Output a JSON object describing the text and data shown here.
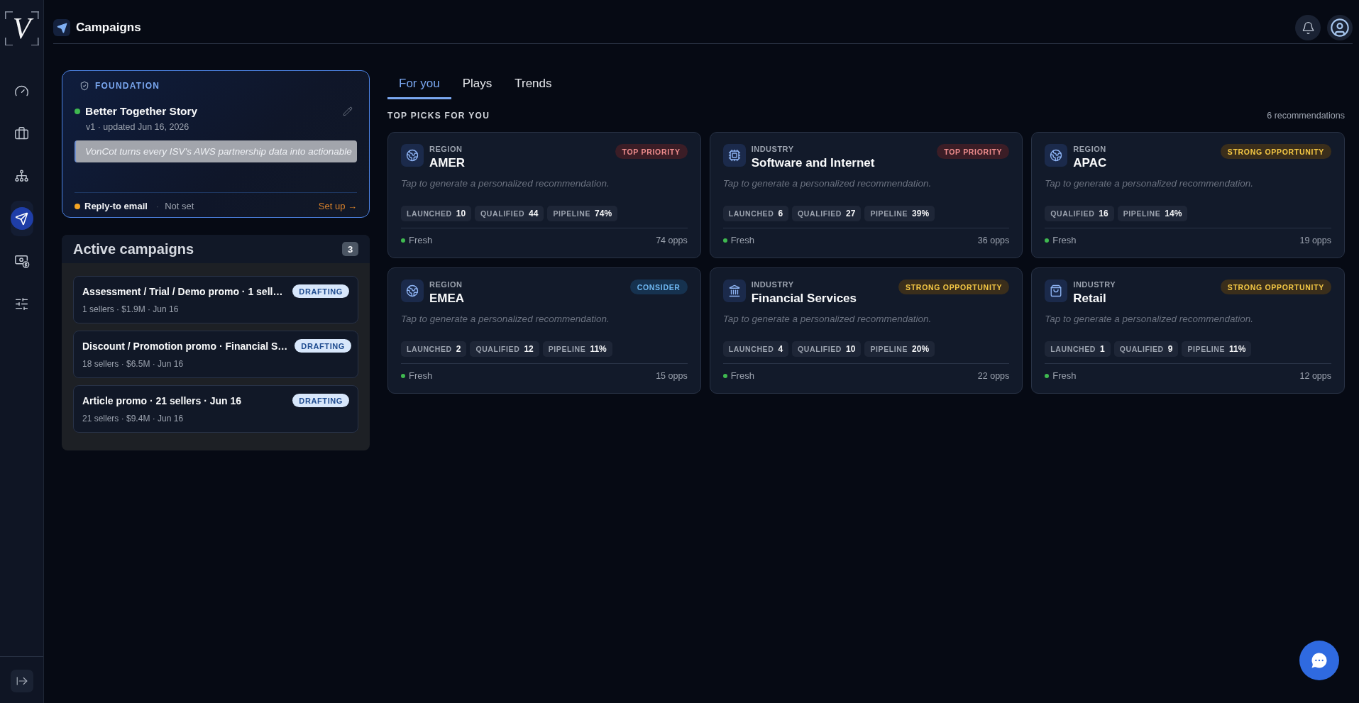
{
  "sidebar": {
    "logo": "V",
    "nav_items": [
      {
        "kind": "dashboard",
        "selected": false
      },
      {
        "kind": "portfolio",
        "selected": false
      },
      {
        "kind": "hierarchy",
        "selected": false
      },
      {
        "kind": "campaigns",
        "selected": true
      },
      {
        "kind": "billing",
        "selected": false
      },
      {
        "kind": "settings",
        "selected": false
      }
    ]
  },
  "header": {
    "title": "Campaigns"
  },
  "foundation": {
    "label": "FOUNDATION",
    "story": {
      "title": "Better Together Story",
      "color": "#3fb950",
      "meta": "v1 · updated Jun 16, 2026",
      "excerpt": "VonCot turns every ISV's AWS partnership data into actionable"
    },
    "reply_to": {
      "label": "Reply-to email",
      "color": "#f5a524",
      "separator": "·",
      "value": "Not set",
      "action": "Set up →"
    }
  },
  "active_campaigns": {
    "title": "Active campaigns",
    "count": "3",
    "items": [
      {
        "title": "Assessment / Trial / Demo promo · 1 sell…",
        "meta": "1 sellers · $1.9M · Jun 16",
        "status": "DRAFTING"
      },
      {
        "title": "Discount / Promotion promo · Financial S…",
        "meta": "18 sellers · $6.5M · Jun 16",
        "status": "DRAFTING"
      },
      {
        "title": "Article promo · 21 sellers · Jun 16",
        "meta": "21 sellers · $9.4M · Jun 16",
        "status": "DRAFTING"
      }
    ]
  },
  "tabs": [
    {
      "label": "For you",
      "selected": true
    },
    {
      "label": "Plays",
      "selected": false
    },
    {
      "label": "Trends",
      "selected": false
    }
  ],
  "top_picks": {
    "title": "TOP PICKS FOR YOU",
    "count": "6 recommendations",
    "cards": [
      {
        "kind": "region",
        "category": "REGION",
        "name": "AMER",
        "badge": {
          "label": "TOP PRIORITY",
          "kind": "top"
        },
        "hint": "Tap to generate a personalized recommendation.",
        "stats": [
          {
            "label": "LAUNCHED",
            "value": "10"
          },
          {
            "label": "QUALIFIED",
            "value": "44"
          },
          {
            "label": "PIPELINE",
            "value": "74%"
          }
        ],
        "freshness": {
          "label": "Fresh",
          "color": "#3fb950"
        },
        "opps": "74 opps"
      },
      {
        "kind": "technology",
        "category": "INDUSTRY",
        "name": "Software and Internet",
        "badge": {
          "label": "TOP PRIORITY",
          "kind": "top"
        },
        "hint": "Tap to generate a personalized recommendation.",
        "stats": [
          {
            "label": "LAUNCHED",
            "value": "6"
          },
          {
            "label": "QUALIFIED",
            "value": "27"
          },
          {
            "label": "PIPELINE",
            "value": "39%"
          }
        ],
        "freshness": {
          "label": "Fresh",
          "color": "#3fb950"
        },
        "opps": "36 opps"
      },
      {
        "kind": "region",
        "category": "REGION",
        "name": "APAC",
        "badge": {
          "label": "STRONG OPPORTUNITY",
          "kind": "strong"
        },
        "hint": "Tap to generate a personalized recommendation.",
        "stats": [
          {
            "label": "QUALIFIED",
            "value": "16"
          },
          {
            "label": "PIPELINE",
            "value": "14%"
          }
        ],
        "freshness": {
          "label": "Fresh",
          "color": "#3fb950"
        },
        "opps": "19 opps"
      },
      {
        "kind": "region",
        "category": "REGION",
        "name": "EMEA",
        "badge": {
          "label": "CONSIDER",
          "kind": "consider"
        },
        "hint": "Tap to generate a personalized recommendation.",
        "stats": [
          {
            "label": "LAUNCHED",
            "value": "2"
          },
          {
            "label": "QUALIFIED",
            "value": "12"
          },
          {
            "label": "PIPELINE",
            "value": "11%"
          }
        ],
        "freshness": {
          "label": "Fresh",
          "color": "#3fb950"
        },
        "opps": "15 opps"
      },
      {
        "kind": "finance",
        "category": "INDUSTRY",
        "name": "Financial Services",
        "badge": {
          "label": "STRONG OPPORTUNITY",
          "kind": "strong"
        },
        "hint": "Tap to generate a personalized recommendation.",
        "stats": [
          {
            "label": "LAUNCHED",
            "value": "4"
          },
          {
            "label": "QUALIFIED",
            "value": "10"
          },
          {
            "label": "PIPELINE",
            "value": "20%"
          }
        ],
        "freshness": {
          "label": "Fresh",
          "color": "#3fb950"
        },
        "opps": "22 opps"
      },
      {
        "kind": "retail",
        "category": "INDUSTRY",
        "name": "Retail",
        "badge": {
          "label": "STRONG OPPORTUNITY",
          "kind": "strong"
        },
        "hint": "Tap to generate a personalized recommendation.",
        "stats": [
          {
            "label": "LAUNCHED",
            "value": "1"
          },
          {
            "label": "QUALIFIED",
            "value": "9"
          },
          {
            "label": "PIPELINE",
            "value": "11%"
          }
        ],
        "freshness": {
          "label": "Fresh",
          "color": "#3fb950"
        },
        "opps": "12 opps"
      }
    ]
  }
}
